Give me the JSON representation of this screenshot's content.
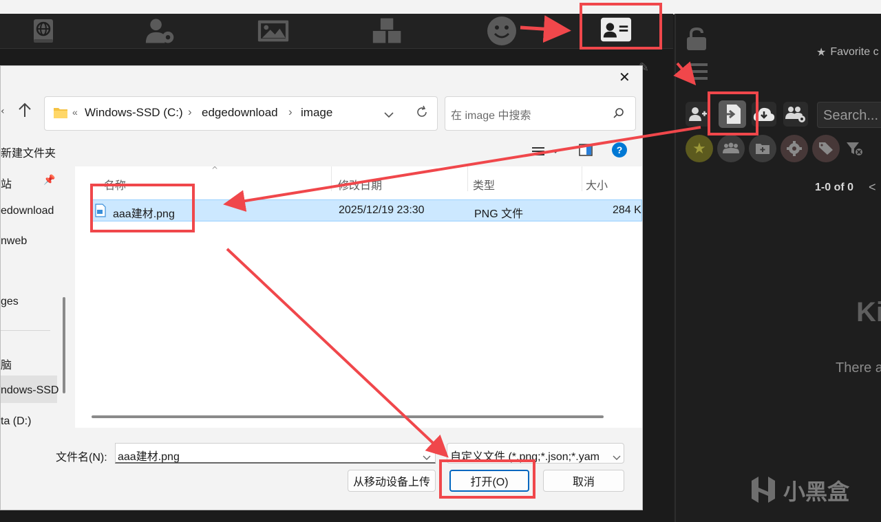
{
  "app_nav": {
    "icons": [
      "globe-book-icon",
      "user-settings-icon",
      "image-icon",
      "cubes-icon",
      "smiley-icon",
      "contact-card-icon"
    ]
  },
  "right_panel": {
    "favorite_label": "Favorite c",
    "search_placeholder": "Search...",
    "pagination": "1-0 of 0",
    "pagination_prev": "<",
    "empty_title": "Ki",
    "empty_text": "There a",
    "watermark_brand": "小黑盒",
    "toolbar_icons": [
      "add-user-icon",
      "import-file-icon",
      "cloud-download-icon",
      "group-settings-icon"
    ],
    "filter_icons": [
      "star-filter-icon",
      "group-filter-icon",
      "folder-filter-icon",
      "gear-filter-icon",
      "tag-filter-icon",
      "clear-filter-icon"
    ]
  },
  "dialog": {
    "close_label": "✕",
    "address": {
      "overflow": "«",
      "segments": [
        "Windows-SSD (C:)",
        "edgedownload",
        "image"
      ],
      "separator": "›"
    },
    "search_placeholder": "在 image 中搜索",
    "new_folder_label": "新建文件夹",
    "help_label": "?",
    "nav_items": [
      "站",
      "edownload",
      "nweb",
      "ges",
      "脑",
      "ndows-SSD",
      "ta (D:)"
    ],
    "columns": {
      "name": "名称",
      "modified": "修改日期",
      "type": "类型",
      "size": "大小"
    },
    "files": [
      {
        "name": "aaa建材.png",
        "modified": "2025/12/19 23:30",
        "type": "PNG 文件",
        "size": "284 K"
      }
    ],
    "filename_label": "文件名(N):",
    "filename_value": "aaa建材.png",
    "filetype_value": "自定义文件 (*.png;*.json;*.yam",
    "upload_button": "从移动设备上传",
    "open_button": "打开(O)",
    "cancel_button": "取消"
  },
  "colors": {
    "annotation_red": "#f0474b",
    "selection_bg": "#cce8ff",
    "app_bg": "#1c1c1c",
    "help_blue": "#0078d4"
  }
}
